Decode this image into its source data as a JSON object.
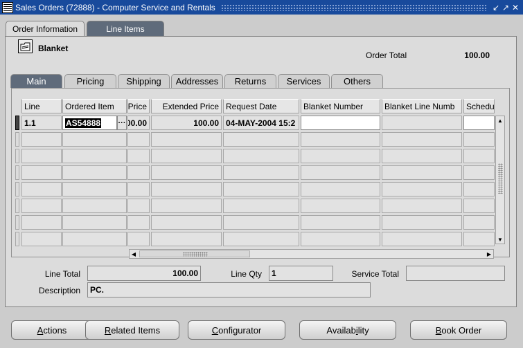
{
  "window": {
    "title": "Sales Orders (72888) - Computer Service and Rentals",
    "controls": [
      "↙",
      "↗",
      "✕"
    ]
  },
  "tabs": [
    {
      "label": "Order Information",
      "active": false
    },
    {
      "label": "Line Items",
      "active": true
    }
  ],
  "header": {
    "blanket_label": "Blanket",
    "order_total_label": "Order Total",
    "order_total_value": "100.00"
  },
  "subtabs": [
    "Main",
    "Pricing",
    "Shipping",
    "Addresses",
    "Returns",
    "Services",
    "Others"
  ],
  "grid": {
    "columns": [
      "Line",
      "Ordered Item",
      "Price",
      "Extended Price",
      "Request Date",
      "Blanket Number",
      "Blanket Line Numb",
      "Schedu"
    ],
    "rows": [
      {
        "line": "1.1",
        "ordered_item": "AS54888",
        "price": "00.00",
        "extended_price": "100.00",
        "request_date": "04-MAY-2004 15:2",
        "blanket_number": "",
        "blanket_line": "",
        "schedule": ""
      }
    ],
    "lov_glyph": "···"
  },
  "footer": {
    "line_total_label": "Line Total",
    "line_total_value": "100.00",
    "line_qty_label": "Line Qty",
    "line_qty_value": "1",
    "service_total_label": "Service Total",
    "service_total_value": "",
    "description_label": "Description",
    "description_value": "PC."
  },
  "buttons": [
    {
      "accel": "A",
      "rest": "ctions"
    },
    {
      "accel": "R",
      "rest": "elated Items"
    },
    {
      "accel": "C",
      "rest": "onfigurator"
    },
    {
      "accel": "",
      "pre": "Availab",
      "mid": "i",
      "post": "lity"
    },
    {
      "accel": "B",
      "rest": "ook Order"
    }
  ]
}
